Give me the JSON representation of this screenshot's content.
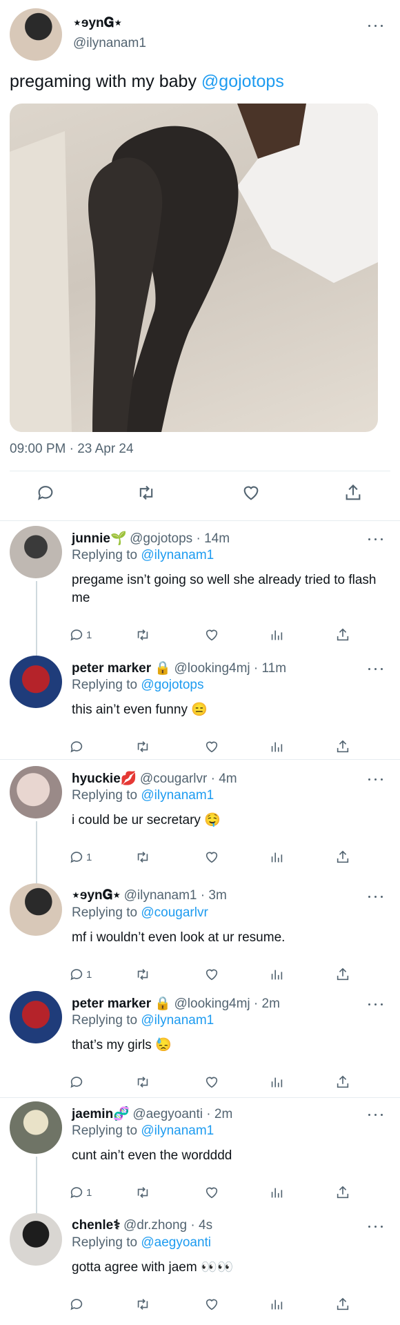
{
  "main": {
    "author": {
      "display_name": "⋆ɘyn𝐆⋆",
      "handle": "@ilynanam1"
    },
    "text": "pregaming with my baby",
    "mention": "@gojotops",
    "timestamp": "09:00 PM · 23 Apr 24"
  },
  "icons": {
    "reply": "reply-icon",
    "retweet": "retweet-icon",
    "like": "heart-icon",
    "views": "views-icon",
    "share": "share-icon",
    "more": "more-icon"
  },
  "colors": {
    "link": "#1d9bf0",
    "muted": "#536471",
    "divider": "#e6ecf0"
  },
  "replies": [
    {
      "name": "junnie🌱",
      "handle": "@gojotops",
      "time": " · 14m",
      "replying_label": "Replying to",
      "replying_to": "@ilynanam1",
      "text": "pregame isn’t going so well she already tried to flash me",
      "reply_count": "1"
    },
    {
      "name": "peter marker 🔒",
      "handle": "@looking4mj",
      "time": " · 11m",
      "replying_label": "Replying to",
      "replying_to": "@gojotops",
      "text": "this ain’t even funny 😑",
      "reply_count": ""
    },
    {
      "name": "hyuckie💋",
      "handle": "@cougarlvr",
      "time": " · 4m",
      "replying_label": "Replying to",
      "replying_to": "@ilynanam1",
      "text": "i could be ur secretary 🤤",
      "reply_count": "1"
    },
    {
      "name": "⋆ɘyn𝐆⋆",
      "handle": "@ilynanam1",
      "time": " · 3m",
      "replying_label": "Replying to",
      "replying_to": "@cougarlvr",
      "text": "mf i wouldn’t even look at ur resume.",
      "reply_count": "1"
    },
    {
      "name": "peter marker 🔒",
      "handle": "@looking4mj",
      "time": " · 2m",
      "replying_label": "Replying to",
      "replying_to": "@ilynanam1",
      "text": "that’s my girls 😓",
      "reply_count": ""
    },
    {
      "name": "jaemin🧬",
      "handle": "@aegyoanti",
      "time": " · 2m",
      "replying_label": "Replying to",
      "replying_to": "@ilynanam1",
      "text": "cunt ain’t even the wordddd",
      "reply_count": "1"
    },
    {
      "name": "chenle⚕",
      "handle": "@dr.zhong",
      "time": " · 4s",
      "replying_label": "Replying to",
      "replying_to": "@aegyoanti",
      "text": "gotta agree with jaem 👀👀",
      "reply_count": ""
    }
  ]
}
